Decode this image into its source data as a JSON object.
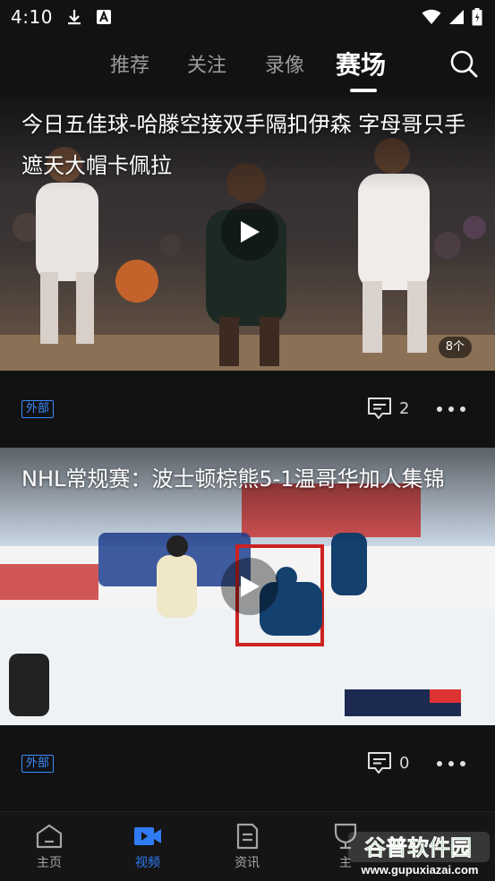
{
  "status_bar": {
    "time": "4:10"
  },
  "top_tabs": [
    {
      "label": "推荐",
      "active": false
    },
    {
      "label": "关注",
      "active": false
    },
    {
      "label": "录像",
      "active": false
    },
    {
      "label": "赛场",
      "active": true
    }
  ],
  "feed": [
    {
      "title": "今日五佳球-哈滕空接双手隔扣伊森 字母哥只手遮天大帽卡佩拉",
      "image_count": "8个",
      "source_tag": "外部",
      "comment_count": "2"
    },
    {
      "title": "NHL常规赛：波士顿棕熊5-1温哥华加人集锦",
      "source_tag": "外部",
      "comment_count": "0"
    }
  ],
  "bottom_nav": [
    {
      "label": "主页",
      "icon": "home-icon",
      "active": false
    },
    {
      "label": "视频",
      "icon": "video-icon",
      "active": true
    },
    {
      "label": "资讯",
      "icon": "document-icon",
      "active": false
    },
    {
      "label": "主",
      "icon": "trophy-icon",
      "active": false
    }
  ],
  "watermark": {
    "brand": "谷普软件园",
    "url": "www.gupuxiazai.com"
  },
  "colors": {
    "accent": "#2f7cf6",
    "tag_blue": "#3d8cff",
    "background": "#121212"
  }
}
